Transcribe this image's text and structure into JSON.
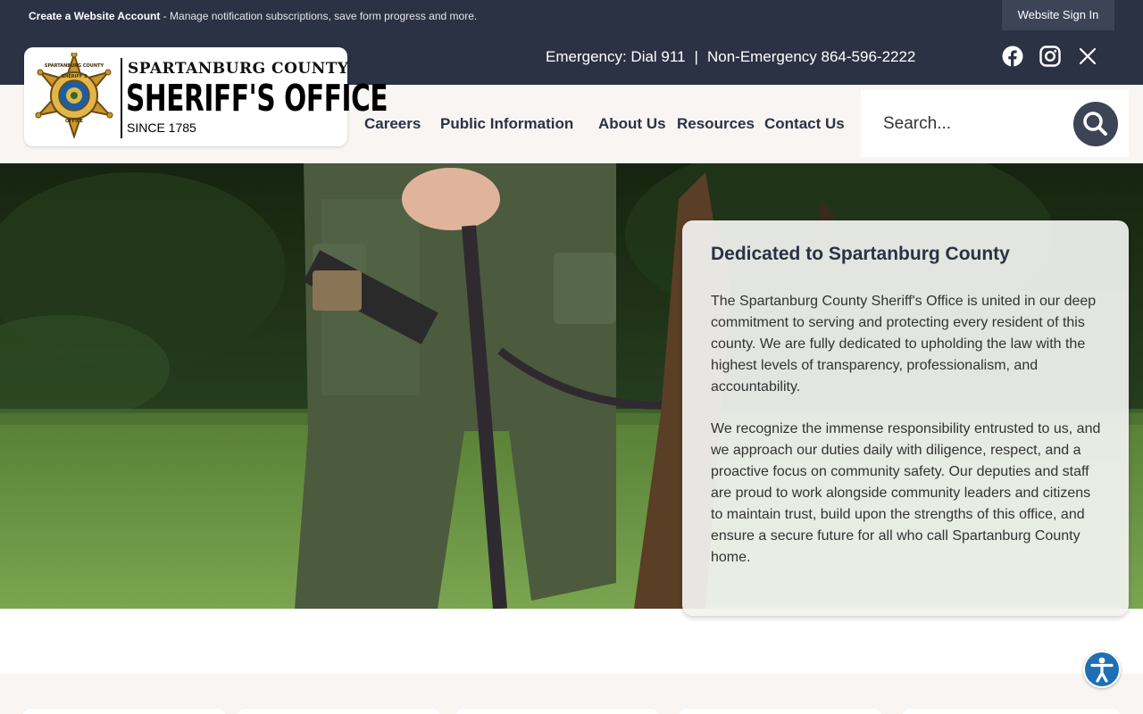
{
  "topbar": {
    "account_link": "Create a Website Account",
    "account_text": " - Manage notification subscriptions, save form progress and more.",
    "signin": "Website Sign In"
  },
  "header": {
    "emergency": "Emergency: Dial 911",
    "separator": "|",
    "non_emergency": "Non-Emergency 864-596-2222",
    "social_icons": [
      "facebook-icon",
      "instagram-icon",
      "x-icon"
    ]
  },
  "logo": {
    "line1": "SPARTANBURG COUNTY",
    "line2": "SHERIFF'S OFFICE",
    "line3": "SINCE 1785",
    "badge_top": "SPARTANBURG COUNTY",
    "badge_mid": "SHERIFF'S",
    "badge_bottom": "OFFICE"
  },
  "nav": {
    "items": [
      "Careers",
      "Public Information",
      "About Us",
      "Resources",
      "Contact Us"
    ]
  },
  "search": {
    "placeholder": "Search..."
  },
  "hero": {
    "title": "Dedicated to Spartanburg County",
    "paragraph1": "The Spartanburg County Sheriff's Office is united in our deep commitment to serving and protecting every resident of this county. We are fully dedicated to upholding the law with the highest levels of transparency, professionalism, and accountability.",
    "paragraph2": "We recognize the immense responsibility entrusted to us, and we approach our duties daily with diligence, respect, and a proactive focus on community safety. Our deputies and staff are proud to work alongside community leaders and citizens to maintain trust, build upon the strengths of this office, and ensure a secure future for all who call Spartanburg County home."
  },
  "colors": {
    "navy": "#2a3244",
    "cream": "#f8f5f2",
    "accessibility_blue": "#1f6fb5",
    "badge_gold": "#c9962e"
  }
}
